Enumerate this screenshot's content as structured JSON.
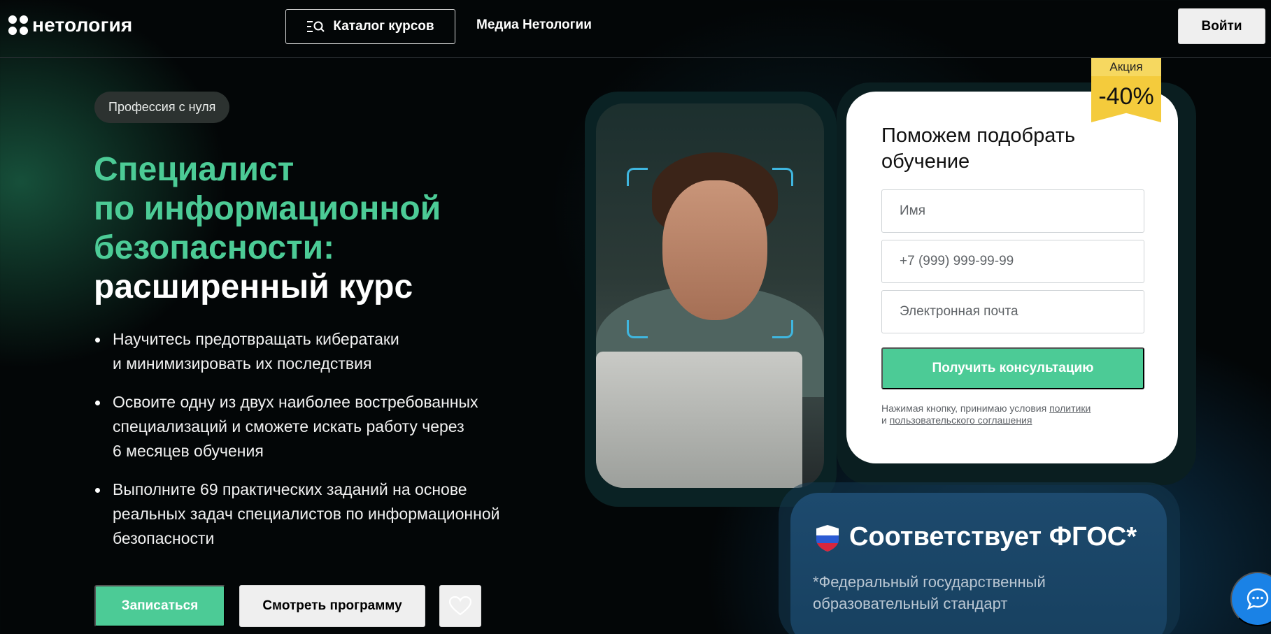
{
  "header": {
    "logo_text": "нетология",
    "catalog_label": "Каталог курсов",
    "media_link": "Медиа Нетологии",
    "login_label": "Войти"
  },
  "hero": {
    "pill": "Профессия с нуля",
    "title_green_lines": [
      "Специалист",
      "по информационной",
      "безопасности:"
    ],
    "title_white": "расширенный курс",
    "bullets": [
      "Научитесь предотвращать кибератаки и минимизировать их последствия",
      "Освоите одну из двух наиболее востребованных специализаций и сможете искать работу через 6 месяцев обучения",
      "Выполните 69 практических заданий на основе реальных задач специалистов по информационной безопасности"
    ],
    "enroll_label": "Записаться",
    "program_label": "Смотреть программу"
  },
  "promo": {
    "label": "Акция",
    "discount": "-40%"
  },
  "form": {
    "title": "Поможем подобрать обучение",
    "name_placeholder": "Имя",
    "phone_placeholder": "+7 (999) 999-99-99",
    "email_placeholder": "Электронная почта",
    "submit_label": "Получить консультацию",
    "consent_prefix": "Нажимая кнопку, принимаю условия",
    "consent_link1": "политики",
    "consent_mid": "и",
    "consent_link2": "пользовательского соглашения"
  },
  "fgos": {
    "title": "Соответствует ФГОС*",
    "note": "*Федеральный государственный образовательный стандарт"
  },
  "colors": {
    "accent_green": "#4ccb96",
    "promo_yellow": "#f4cb3c",
    "chat_blue": "#1a82e6",
    "background": "#030607"
  },
  "icons": [
    "logo-icon",
    "catalog-search-icon",
    "heart-icon",
    "shield-flag-icon",
    "chat-icon"
  ]
}
